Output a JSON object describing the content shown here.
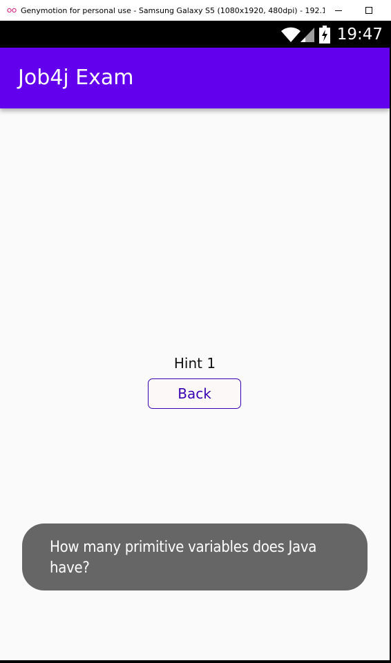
{
  "host_window": {
    "title": "Genymotion for personal use - Samsung Galaxy S5 (1080x1920, 480dpi) - 192.168....",
    "app_icon": "genymotion-icon",
    "minimize_icon": "minimize-icon",
    "maximize_icon": "maximize-icon"
  },
  "status_bar": {
    "time": "19:47",
    "icons": [
      "wifi-icon",
      "signal-icon",
      "battery-charging-icon"
    ]
  },
  "app_bar": {
    "title": "Job4j Exam",
    "color": "#6200ee"
  },
  "content": {
    "hint_text": "Hint 1",
    "back_button_label": "Back",
    "accent_color": "#3700b3"
  },
  "toast": {
    "message": "How many primitive variables does Java have?",
    "background": "#666666"
  }
}
